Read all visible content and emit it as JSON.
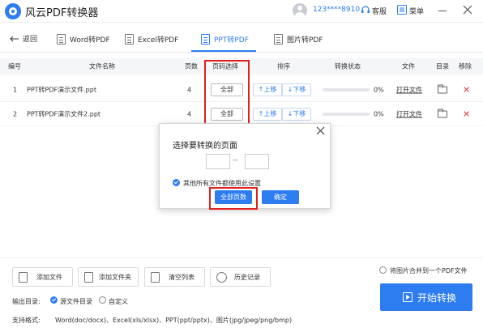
{
  "app": {
    "title": "风云PDF转换器",
    "user": "123****8910",
    "service": "客服",
    "menu": "菜单"
  },
  "nav": {
    "back": "返回",
    "tabs": [
      {
        "label": "Word转PDF",
        "active": false
      },
      {
        "label": "Excel转PDF",
        "active": false
      },
      {
        "label": "PPT转PDF",
        "active": true
      },
      {
        "label": "图片转PDF",
        "active": false
      }
    ]
  },
  "table": {
    "headers": {
      "index": "编号",
      "name": "文件名称",
      "pages": "页数",
      "page_select": "页码选择",
      "order": "排序",
      "status": "转换状态",
      "file": "文件",
      "dir": "目录",
      "remove": "移除"
    },
    "rows": [
      {
        "index": "1",
        "name": "PPT转PDF演示文件.ppt",
        "pages": "4",
        "page_btn": "全部",
        "up": "↑上移",
        "down": "↓下移",
        "progress": "0%",
        "open": "打开文件",
        "progress_fraction": 0
      },
      {
        "index": "2",
        "name": "PPT转PDF演示文件2.ppt",
        "pages": "4",
        "page_btn": "全部",
        "up": "↑上移",
        "down": "↓下移",
        "progress": "0%",
        "open": "打开文件",
        "progress_fraction": 0
      }
    ]
  },
  "dialog": {
    "title": "选择要转换的页面",
    "from_value": "",
    "separator": "--",
    "to_value": "",
    "apply_all_label": "其他所有文件都使用此设置",
    "all_pages_button": "全部页数",
    "confirm_button": "确定"
  },
  "bottom": {
    "add_file": "添加文件",
    "add_folder": "添加文件夹",
    "clear_list": "清空列表",
    "history": "历史记录",
    "merge_images": "将图片合并到一个PDF文件",
    "start": "开始转换",
    "output_label": "输出目录:",
    "output_options": [
      "源文件目录",
      "自定义"
    ],
    "formats_label": "支持格式:",
    "formats_value": "Word(doc/docx)、Excel(xls/xlsx)、PPT(ppt/pptx)、图片(jpg/jpeg/png/bmp)"
  },
  "colors": {
    "accent": "#2d7cf0",
    "highlight": "#e02020",
    "remove": "#e0393e"
  }
}
